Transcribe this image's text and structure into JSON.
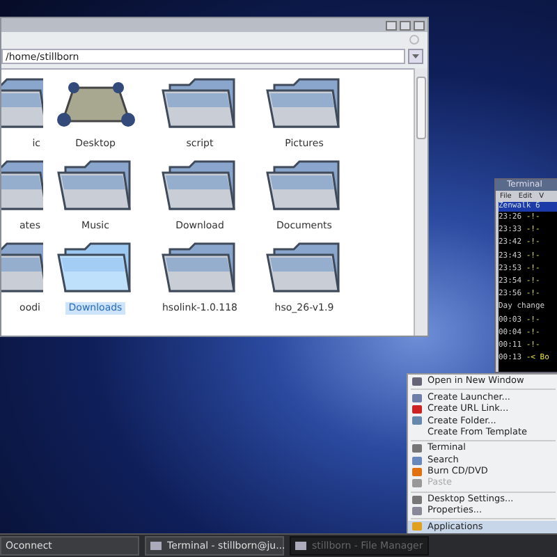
{
  "file_manager": {
    "path": "/home/stillborn",
    "rows": [
      [
        {
          "label": "ic",
          "kind": "folder",
          "selected": false
        },
        {
          "label": "Desktop",
          "kind": "desktop",
          "selected": false
        },
        {
          "label": "script",
          "kind": "folder",
          "selected": false
        },
        {
          "label": "Pictures",
          "kind": "folder",
          "selected": false
        }
      ],
      [
        {
          "label": "ates",
          "kind": "folder",
          "selected": false
        },
        {
          "label": "Music",
          "kind": "folder",
          "selected": false
        },
        {
          "label": "Download",
          "kind": "folder",
          "selected": false
        },
        {
          "label": "Documents",
          "kind": "folder",
          "selected": false
        }
      ],
      [
        {
          "label": "oodi",
          "kind": "folder",
          "selected": false
        },
        {
          "label": "Downloads",
          "kind": "folder",
          "selected": true
        },
        {
          "label": "hsolink-1.0.118",
          "kind": "folder",
          "selected": false
        },
        {
          "label": "hso_26-v1.9",
          "kind": "folder",
          "selected": false
        }
      ]
    ]
  },
  "terminal": {
    "title": "Terminal",
    "menu": [
      "File",
      "Edit",
      "V"
    ],
    "header": "Zenwalk 6",
    "lines": [
      {
        "time": "23:26",
        "text": "-!-"
      },
      {
        "time": "23:33",
        "text": "-!-"
      },
      {
        "time": "23:42",
        "text": "-!-"
      },
      {
        "time": "23:43",
        "text": "-!-"
      },
      {
        "time": "23:53",
        "text": "-!-"
      },
      {
        "time": "23:54",
        "text": "-!-"
      },
      {
        "time": "23:56",
        "text": "-!-"
      },
      {
        "time": "Day change"
      },
      {
        "time": "00:03",
        "text": "-!-"
      },
      {
        "time": "00:04",
        "text": "-!-"
      },
      {
        "time": "00:11",
        "text": "-!-"
      },
      {
        "time": "00:13",
        "text": "-< Bo"
      }
    ]
  },
  "context_menu": [
    {
      "kind": "item",
      "label": "Open in New Window",
      "disabled": false,
      "selected": false
    },
    {
      "kind": "separator"
    },
    {
      "kind": "item",
      "label": "Create Launcher...",
      "disabled": false,
      "selected": false
    },
    {
      "kind": "item",
      "label": "Create URL Link...",
      "disabled": false,
      "selected": false
    },
    {
      "kind": "item",
      "label": "Create Folder...",
      "disabled": false,
      "selected": false
    },
    {
      "kind": "item",
      "label": "Create From Template",
      "disabled": false,
      "selected": false
    },
    {
      "kind": "separator"
    },
    {
      "kind": "item",
      "label": "Terminal",
      "disabled": false,
      "selected": false
    },
    {
      "kind": "item",
      "label": "Search",
      "disabled": false,
      "selected": false
    },
    {
      "kind": "item",
      "label": "Burn CD/DVD",
      "disabled": false,
      "selected": false
    },
    {
      "kind": "item",
      "label": "Paste",
      "disabled": true,
      "selected": false
    },
    {
      "kind": "separator"
    },
    {
      "kind": "item",
      "label": "Desktop Settings...",
      "disabled": false,
      "selected": false
    },
    {
      "kind": "item",
      "label": "Properties...",
      "disabled": false,
      "selected": false
    },
    {
      "kind": "separator"
    },
    {
      "kind": "item",
      "label": "Applications",
      "disabled": false,
      "selected": true
    }
  ],
  "taskbar": [
    {
      "label": "Oconnect",
      "selected": false
    },
    {
      "label": "Terminal - stillborn@ju...",
      "selected": false
    },
    {
      "label": "stillborn - File Manager",
      "selected": true
    }
  ]
}
